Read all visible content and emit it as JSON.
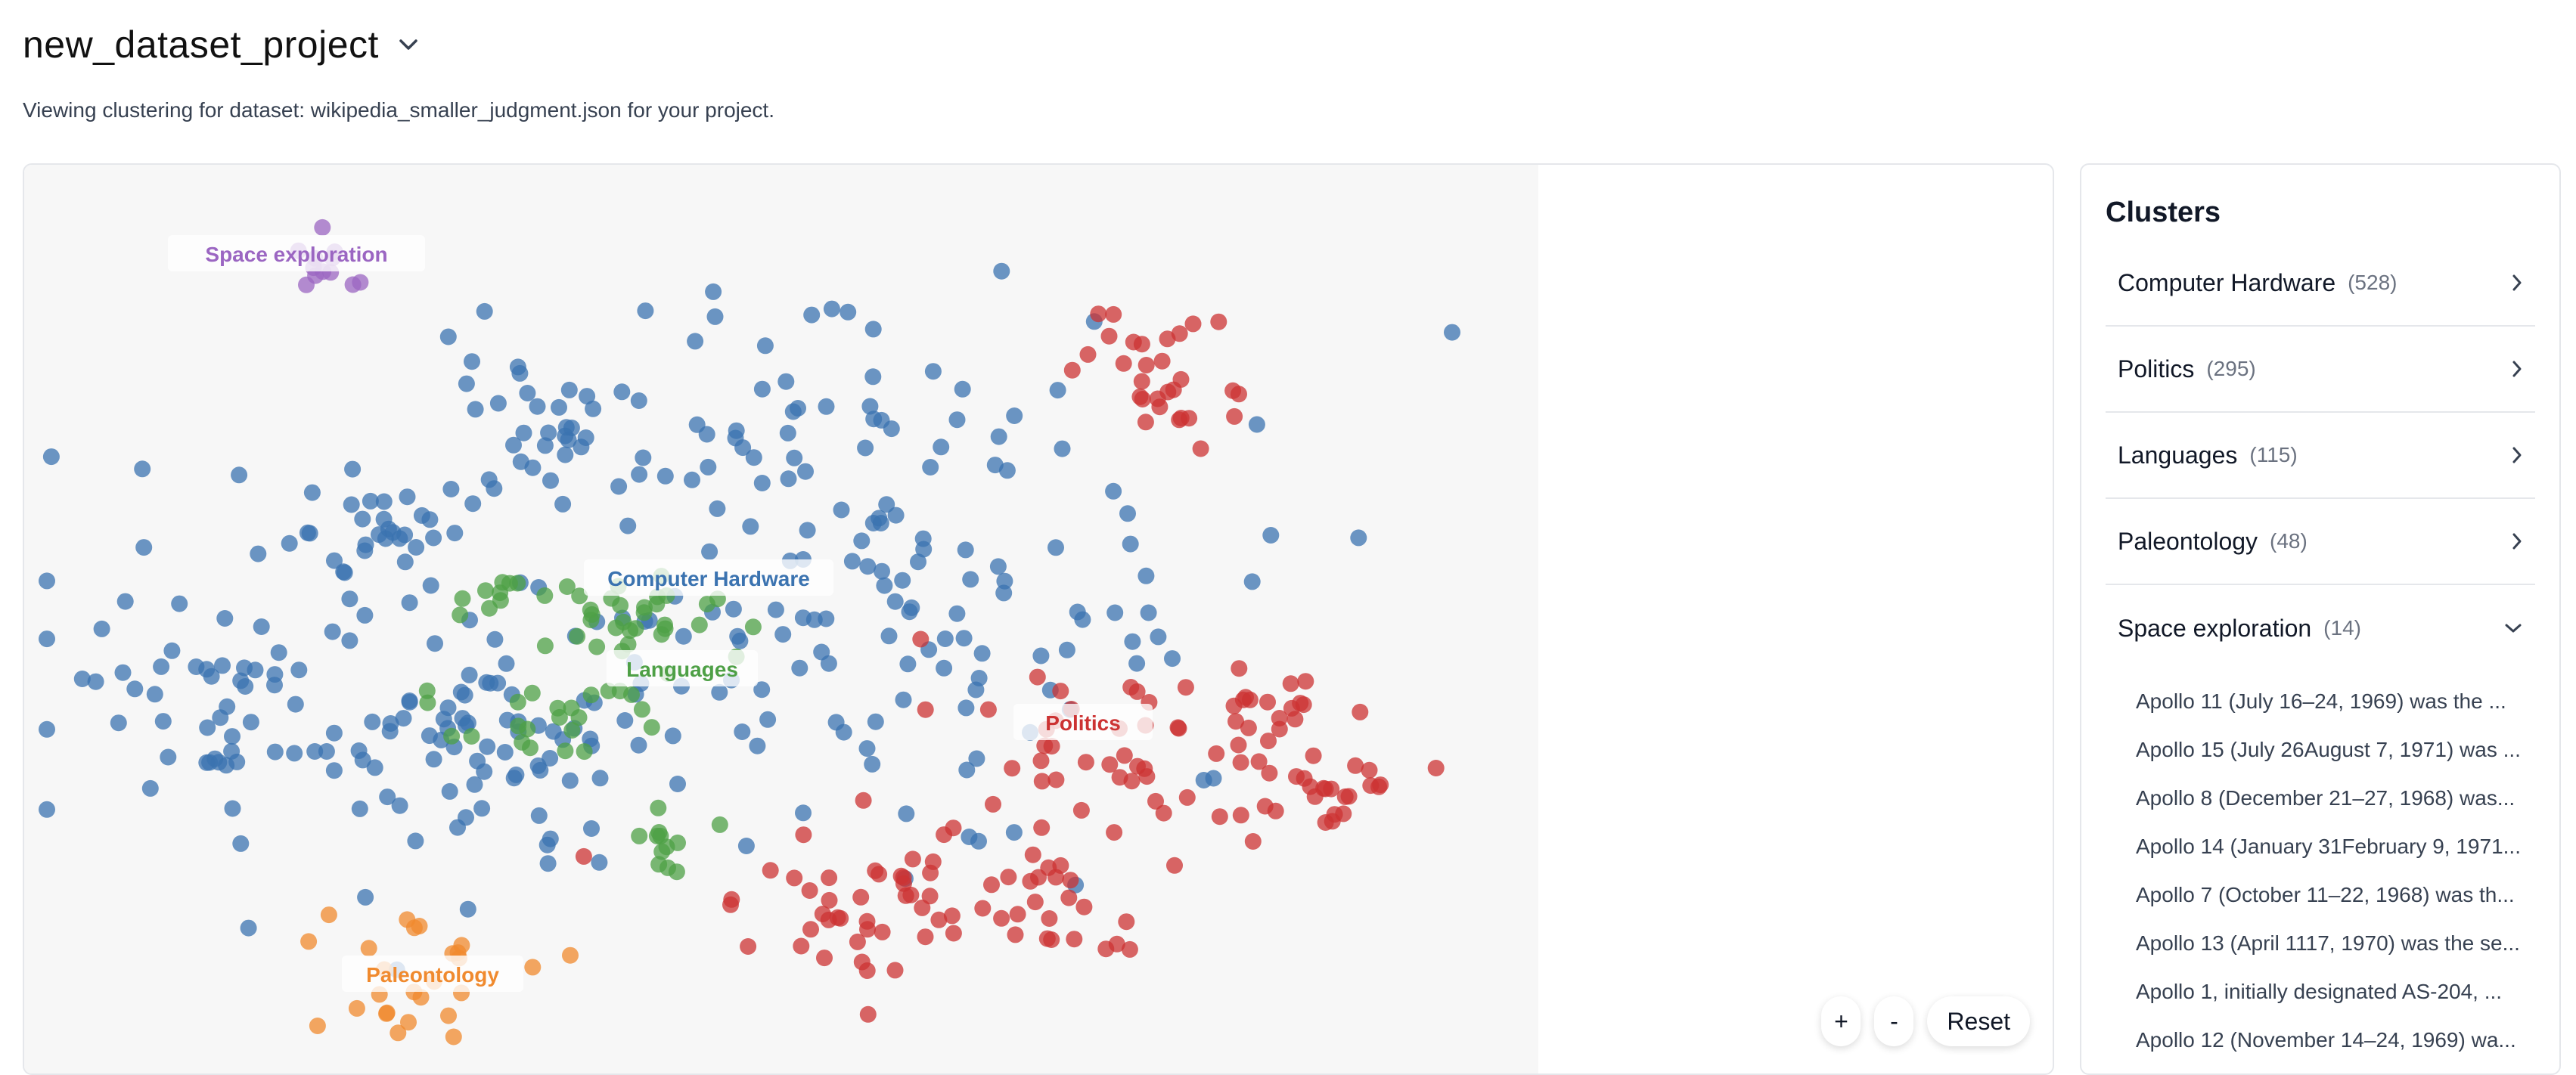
{
  "header": {
    "project_name": "new_dataset_project",
    "subtitle": "Viewing clustering for dataset: wikipedia_smaller_judgment.json for your project."
  },
  "colors": {
    "computer_hardware": "#3b73b0",
    "politics": "#cc3333",
    "languages": "#4ea046",
    "paleontology": "#f08a2e",
    "space_exploration": "#9b66c2"
  },
  "plot": {
    "labels": {
      "space": "Space exploration",
      "hardware": "Computer Hardware",
      "languages": "Languages",
      "politics": "Politics",
      "paleontology": "Paleontology"
    }
  },
  "zoom": {
    "plus": "+",
    "minus": "-",
    "reset": "Reset"
  },
  "sidebar": {
    "title": "Clusters",
    "clusters": [
      {
        "name": "Computer Hardware",
        "count": "(528)"
      },
      {
        "name": "Politics",
        "count": "(295)"
      },
      {
        "name": "Languages",
        "count": "(115)"
      },
      {
        "name": "Paleontology",
        "count": "(48)"
      },
      {
        "name": "Space exploration",
        "count": "(14)"
      }
    ],
    "documents": [
      "Apollo 11 (July 16–24, 1969) was the ...",
      "Apollo 15 (July 26August 7, 1971) was ...",
      "Apollo 8 (December 21–27, 1968) was...",
      "Apollo 14 (January 31February 9, 1971...",
      "Apollo 7 (October 11–22, 1968) was th...",
      "Apollo 13 (April 1117, 1970) was the se...",
      "Apollo 1, initially designated AS-204, ...",
      "Apollo 12 (November 14–24, 1969) wa..."
    ]
  }
}
